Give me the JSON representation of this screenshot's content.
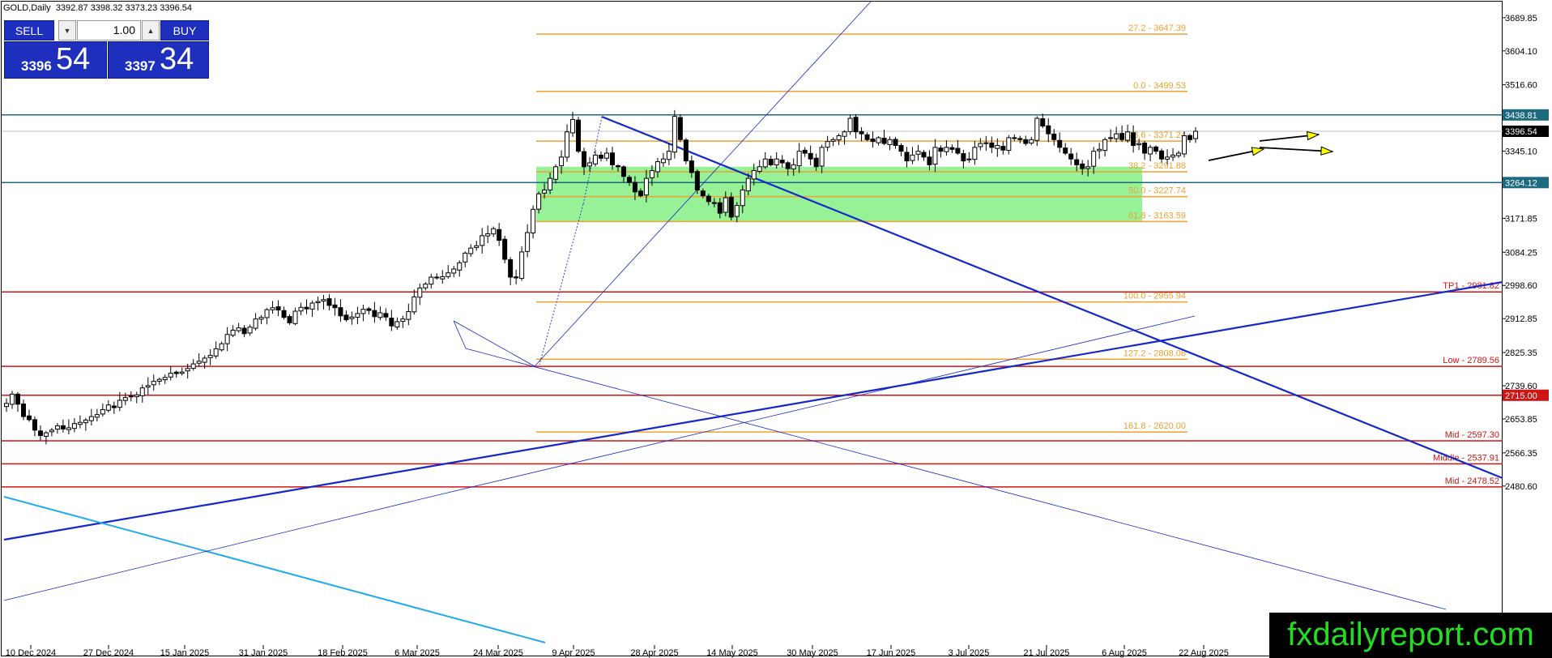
{
  "header": {
    "symbol": "GOLD,Daily",
    "ohlc": "3392.87 3398.32 3373.23 3396.54"
  },
  "trade_panel": {
    "sell_label": "SELL",
    "buy_label": "BUY",
    "lot": "1.00",
    "bid_small": "3396",
    "bid_big": "54",
    "ask_small": "3397",
    "ask_big": "34",
    "down_arrow": "▼",
    "up_arrow": "▲"
  },
  "watermark": "fxdailyreport.com",
  "colors": {
    "fib": "#f0a030",
    "level_red": "#d01515",
    "level_teal": "#1c6a80",
    "trend_blue": "#1428c8",
    "trend_cyan": "#22aaee",
    "zone_green": "#8cf08c",
    "bid_panel": "#1f2fbd",
    "watermark_text": "#22dd22"
  },
  "chart_data": {
    "type": "candlestick",
    "title": "GOLD,Daily",
    "x_tick_labels": [
      "10 Dec 2024",
      "27 Dec 2024",
      "15 Jan 2025",
      "31 Jan 2025",
      "18 Feb 2025",
      "6 Mar 2025",
      "24 Mar 2025",
      "9 Apr 2025",
      "28 Apr 2025",
      "14 May 2025",
      "30 May 2025",
      "17 Jun 2025",
      "3 Jul 2025",
      "21 Jul 2025",
      "6 Aug 2025",
      "22 Aug 2025"
    ],
    "y_tick_labels": [
      "3689.85",
      "3604.10",
      "3516.60",
      "3345.10",
      "3171.85",
      "3084.25",
      "2998.60",
      "2912.85",
      "2825.35",
      "2739.60",
      "2653.85",
      "2566.35",
      "2480.60"
    ],
    "ylim": [
      2443,
      3738
    ],
    "current_price": "3396.54",
    "closes": [
      2694,
      2718,
      2692,
      2660,
      2652,
      2625,
      2611,
      2618,
      2625,
      2636,
      2628,
      2631,
      2642,
      2645,
      2651,
      2660,
      2665,
      2678,
      2690,
      2683,
      2702,
      2709,
      2713,
      2716,
      2734,
      2740,
      2751,
      2756,
      2761,
      2772,
      2771,
      2775,
      2784,
      2796,
      2803,
      2811,
      2818,
      2835,
      2848,
      2872,
      2883,
      2889,
      2874,
      2891,
      2912,
      2916,
      2936,
      2941,
      2935,
      2916,
      2902,
      2932,
      2942,
      2938,
      2953,
      2957,
      2962,
      2947,
      2941,
      2920,
      2910,
      2917,
      2926,
      2937,
      2934,
      2918,
      2928,
      2917,
      2894,
      2905,
      2912,
      2931,
      2969,
      2992,
      3002,
      3020,
      3018,
      3021,
      3031,
      3041,
      3057,
      3082,
      3095,
      3101,
      3127,
      3132,
      3145,
      3115,
      3066,
      3020,
      3018,
      3085,
      3135,
      3195,
      3235,
      3245,
      3275,
      3305,
      3330,
      3395,
      3427,
      3345,
      3305,
      3315,
      3335,
      3327,
      3340,
      3310,
      3305,
      3280,
      3265,
      3240,
      3230,
      3275,
      3295,
      3318,
      3325,
      3345,
      3435,
      3375,
      3320,
      3290,
      3245,
      3230,
      3215,
      3210,
      3185,
      3225,
      3175,
      3205,
      3245,
      3275,
      3295,
      3305,
      3325,
      3310,
      3325,
      3315,
      3300,
      3310,
      3345,
      3340,
      3325,
      3305,
      3355,
      3370,
      3375,
      3385,
      3395,
      3430,
      3395,
      3390,
      3375,
      3370,
      3380,
      3365,
      3375,
      3360,
      3345,
      3320,
      3335,
      3345,
      3330,
      3310,
      3355,
      3345,
      3355,
      3350,
      3340,
      3320,
      3325,
      3355,
      3365,
      3365,
      3355,
      3360,
      3348,
      3380,
      3380,
      3375,
      3365,
      3375,
      3430,
      3410,
      3390,
      3375,
      3355,
      3340,
      3325,
      3310,
      3300,
      3305,
      3345,
      3350,
      3375,
      3380,
      3390,
      3375,
      3395,
      3360,
      3365,
      3340,
      3355,
      3345,
      3325,
      3330,
      3335,
      3340,
      3385,
      3375,
      3396.54
    ],
    "fib_levels": [
      {
        "label": "27.2 - 3647.39",
        "value": 3647.39
      },
      {
        "label": "0.0 - 3499.53",
        "value": 3499.53
      },
      {
        "label": "23.6 - 3371.24",
        "value": 3371.24
      },
      {
        "label": "38.2 - 3291.88",
        "value": 3291.88
      },
      {
        "label": "50.0 - 3227.74",
        "value": 3227.74
      },
      {
        "label": "61.8 - 3163.59",
        "value": 3163.59
      },
      {
        "label": "100.0 - 2955.94",
        "value": 2955.94
      },
      {
        "label": "127.2 - 2808.08",
        "value": 2808.08
      },
      {
        "label": "161.8 - 2620.00",
        "value": 2620.0
      }
    ],
    "horizontal_levels": [
      {
        "label": "TP1 - 2981.82",
        "value": 2981.82,
        "color": "red"
      },
      {
        "label": "Low - 2789.56",
        "value": 2789.56,
        "color": "red"
      },
      {
        "label": "",
        "value": 2715.0,
        "color": "red",
        "axis_tag": "2715.00"
      },
      {
        "label": "Mid - 2597.30",
        "value": 2597.3,
        "color": "red"
      },
      {
        "label": "Middle - 2537.91",
        "value": 2537.91,
        "color": "red"
      },
      {
        "label": "Mid - 2478.52",
        "value": 2478.52,
        "color": "red"
      },
      {
        "label": "",
        "value": 3438.81,
        "color": "teal",
        "axis_tag": "3438.81"
      },
      {
        "label": "",
        "value": 3264.12,
        "color": "teal",
        "axis_tag": "3264.12"
      }
    ],
    "zone": {
      "top": 3305,
      "bottom": 3163.59
    }
  }
}
